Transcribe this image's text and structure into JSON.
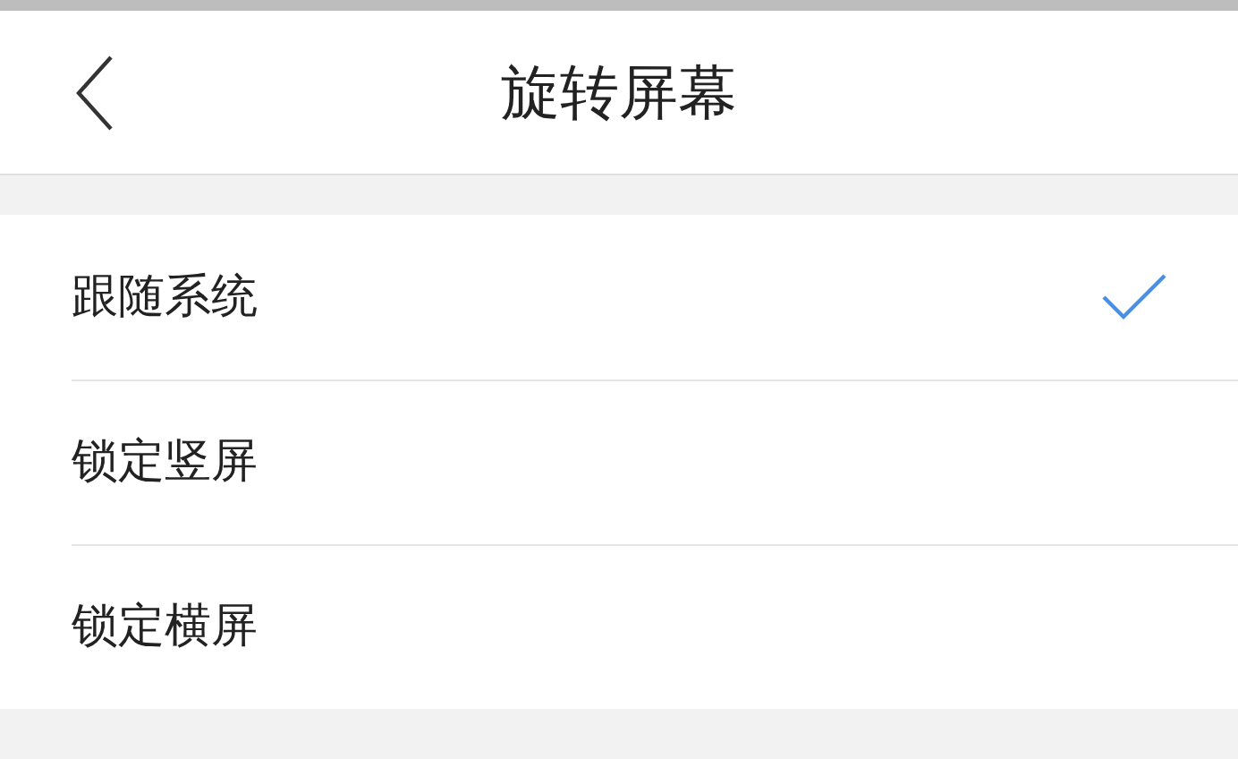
{
  "header": {
    "title": "旋转屏幕"
  },
  "options": [
    {
      "label": "跟随系统",
      "selected": true
    },
    {
      "label": "锁定竖屏",
      "selected": false
    },
    {
      "label": "锁定横屏",
      "selected": false
    }
  ]
}
